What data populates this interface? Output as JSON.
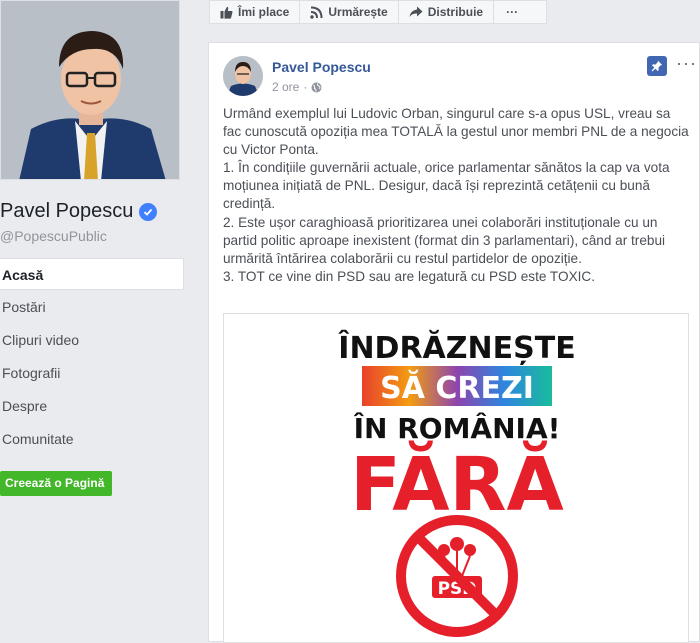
{
  "sidebar": {
    "page_name": "Pavel Popescu",
    "handle": "@PopescuPublic",
    "nav": [
      "Acasă",
      "Postări",
      "Clipuri video",
      "Fotografii",
      "Despre",
      "Comunitate"
    ],
    "create_page_label": "Creează o Pagină"
  },
  "actions": {
    "like": "Îmi place",
    "follow": "Urmărește",
    "share": "Distribuie",
    "more": "···"
  },
  "post": {
    "author": "Pavel Popescu",
    "time": "2 ore",
    "paragraphs": [
      "Urmând exemplul lui Ludovic Orban, singurul care s-a opus USL, vreau sa fac cunoscută opoziția mea TOTALĂ la gestul unor membri PNL de a negocia cu Victor Ponta.",
      "1. În condițiile guvernării actuale, orice parlamentar sănătos la cap va vota moțiunea inițiată de PNL. Desigur, dacă își reprezintă cetățenii cu bună credință.",
      "2. Este ușor caraghioasă prioritizarea unei colaborări instituționale cu un partid politic aproape inexistent (format din 3 parlamentari), când ar trebui urmărită întărirea colaborării cu restul partidelor de opoziție.",
      "3. TOT ce vine din PSD sau are legatură cu PSD este TOXIC."
    ],
    "image": {
      "line1": "ÎNDRĂZNEȘTE",
      "line2": "SĂ CREZI",
      "line3_a": "ÎN ",
      "line3_b": "ROMÂNIA!",
      "line4": "FĂRĂ",
      "logo_text": "PSD"
    }
  },
  "colors": {
    "link": "#365899",
    "accent_blue": "#4267b2",
    "green_button": "#42b72a",
    "poster_red": "#e5202a"
  }
}
